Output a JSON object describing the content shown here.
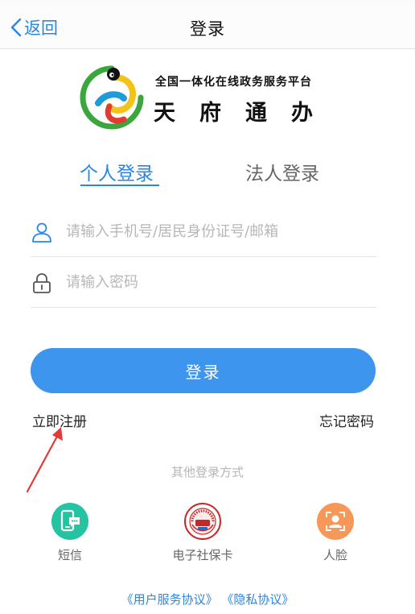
{
  "nav": {
    "back_label": "返回",
    "title": "登录"
  },
  "logo": {
    "subtitle": "全国一体化在线政务服务平台",
    "name": "天府通办"
  },
  "tabs": [
    {
      "label": "个人登录",
      "active": true
    },
    {
      "label": "法人登录",
      "active": false
    }
  ],
  "form": {
    "account_placeholder": "请输入手机号/居民身份证号/邮箱",
    "account_value": "",
    "password_placeholder": "请输入密码",
    "password_value": ""
  },
  "login_button": "登录",
  "links": {
    "register": "立即注册",
    "forgot": "忘记密码"
  },
  "other_login": {
    "title": "其他登录方式",
    "options": [
      {
        "label": "短信",
        "icon": "sms-phone-icon",
        "color": "#24c4a2"
      },
      {
        "label": "电子社保卡",
        "icon": "social-security-card-icon"
      },
      {
        "label": "人脸",
        "icon": "face-scan-icon",
        "color": "#f79858"
      }
    ]
  },
  "agreements": {
    "user_service": "《用户服务协议》",
    "privacy": "《隐私协议》"
  },
  "colors": {
    "accent": "#2a86e5",
    "button": "#3d95ee",
    "annotation_arrow": "#e53935"
  }
}
